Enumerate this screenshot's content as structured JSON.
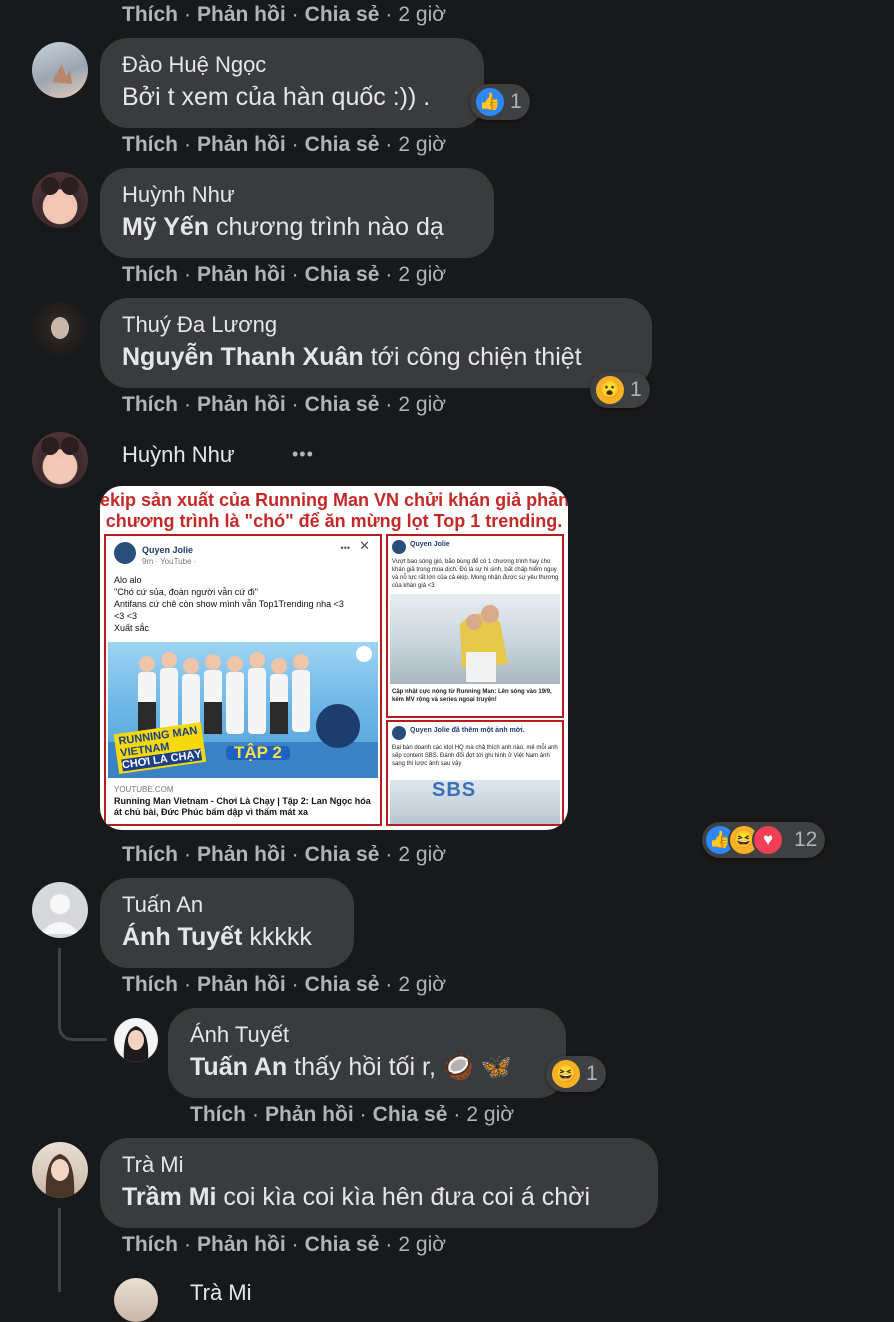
{
  "actions": {
    "like": "Thích",
    "reply": "Phản hồi",
    "share": "Chia sẻ",
    "sep": "·",
    "time": "2 giờ"
  },
  "comments": [
    {
      "name": "Đào Huệ Ngọc",
      "mention": "",
      "text": "Bởi t xem của hàn quốc :)) .",
      "reaction_count": "1"
    },
    {
      "name": "Huỳnh Như",
      "mention": "Mỹ Yến",
      "text": " chương trình nào dạ"
    },
    {
      "name": "Thuý Đa Lương",
      "mention": "Nguyễn Thanh Xuân",
      "text": " tới công chiện thiệt",
      "reaction_count": "1"
    },
    {
      "name": "Huỳnh Như",
      "more": "•••",
      "reaction_count": "12",
      "image": {
        "headline1": "ekip sản xuất của Running Man VN chửi khán giả phản đối",
        "headline2": "chương trình là \"chó\" để ăn mừng lọt Top 1 trending.",
        "post_author": "Quyen Jolie",
        "post_meta": "9m · YouTube ·",
        "post_line1": "Alo alo",
        "post_line2": "\"Chó cứ sủa, đoàn người vẫn cứ đi\"",
        "post_line3": "Antifans cứ chê còn show mình vẫn Top1Trending nha <3",
        "post_line4": "<3 <3",
        "post_line5": "Xuất sắc",
        "banner1": "RUNNING MAN",
        "banner2": "VIETNAM",
        "banner3": "CHƠI LÀ CHẠY",
        "ep": "TẬP 2",
        "link_domain": "YOUTUBE.COM",
        "link_title": "Running Man Vietnam - Chơi Là Chạy | Tập 2: Lan Ngọc hóa át chủ bài, Đức Phúc bấm dập vì thấm mát xa",
        "right_author": "Quyen Jolie",
        "right_text": "Vượt bao sóng gió, bão bùng để có 1 chương trình hay cho khán giả trong mùa dịch. Đó là sự hi sinh, bất chấp hiểm nguy và nỗ lực rất lớn của cả ekip. Mong nhận được sự yêu thương của khán giả <3",
        "right_caption": "Cập nhật cực nóng từ Running Man: Lên sóng vào 19/9, kèm MV rộng và series ngoại truyện!",
        "right2_author": "Quyen Jolie đã thêm một ảnh mới.",
        "right2_text": "Đại bàn doanh các idol HQ mà chả thích anh nào, mê mỗi anh sếp content SBS. Đánh đổi đợt tới ghi hình ở Việt Nam ảnh sang thì lược ảnh sau vậy",
        "sbs": "SBS"
      }
    },
    {
      "name": "Tuấn An",
      "mention": "Ánh Tuyết",
      "text": " kkkkk"
    },
    {
      "name": "Ánh Tuyết",
      "mention": "Tuấn An",
      "text": " thấy hồi tối r, 🥥 🦋",
      "reaction_count": "1"
    },
    {
      "name": "Trà Mi",
      "mention": "Trầm Mi",
      "text": " coi kìa coi kìa hên đưa coi á chời"
    },
    {
      "name": "Trà Mi"
    }
  ]
}
